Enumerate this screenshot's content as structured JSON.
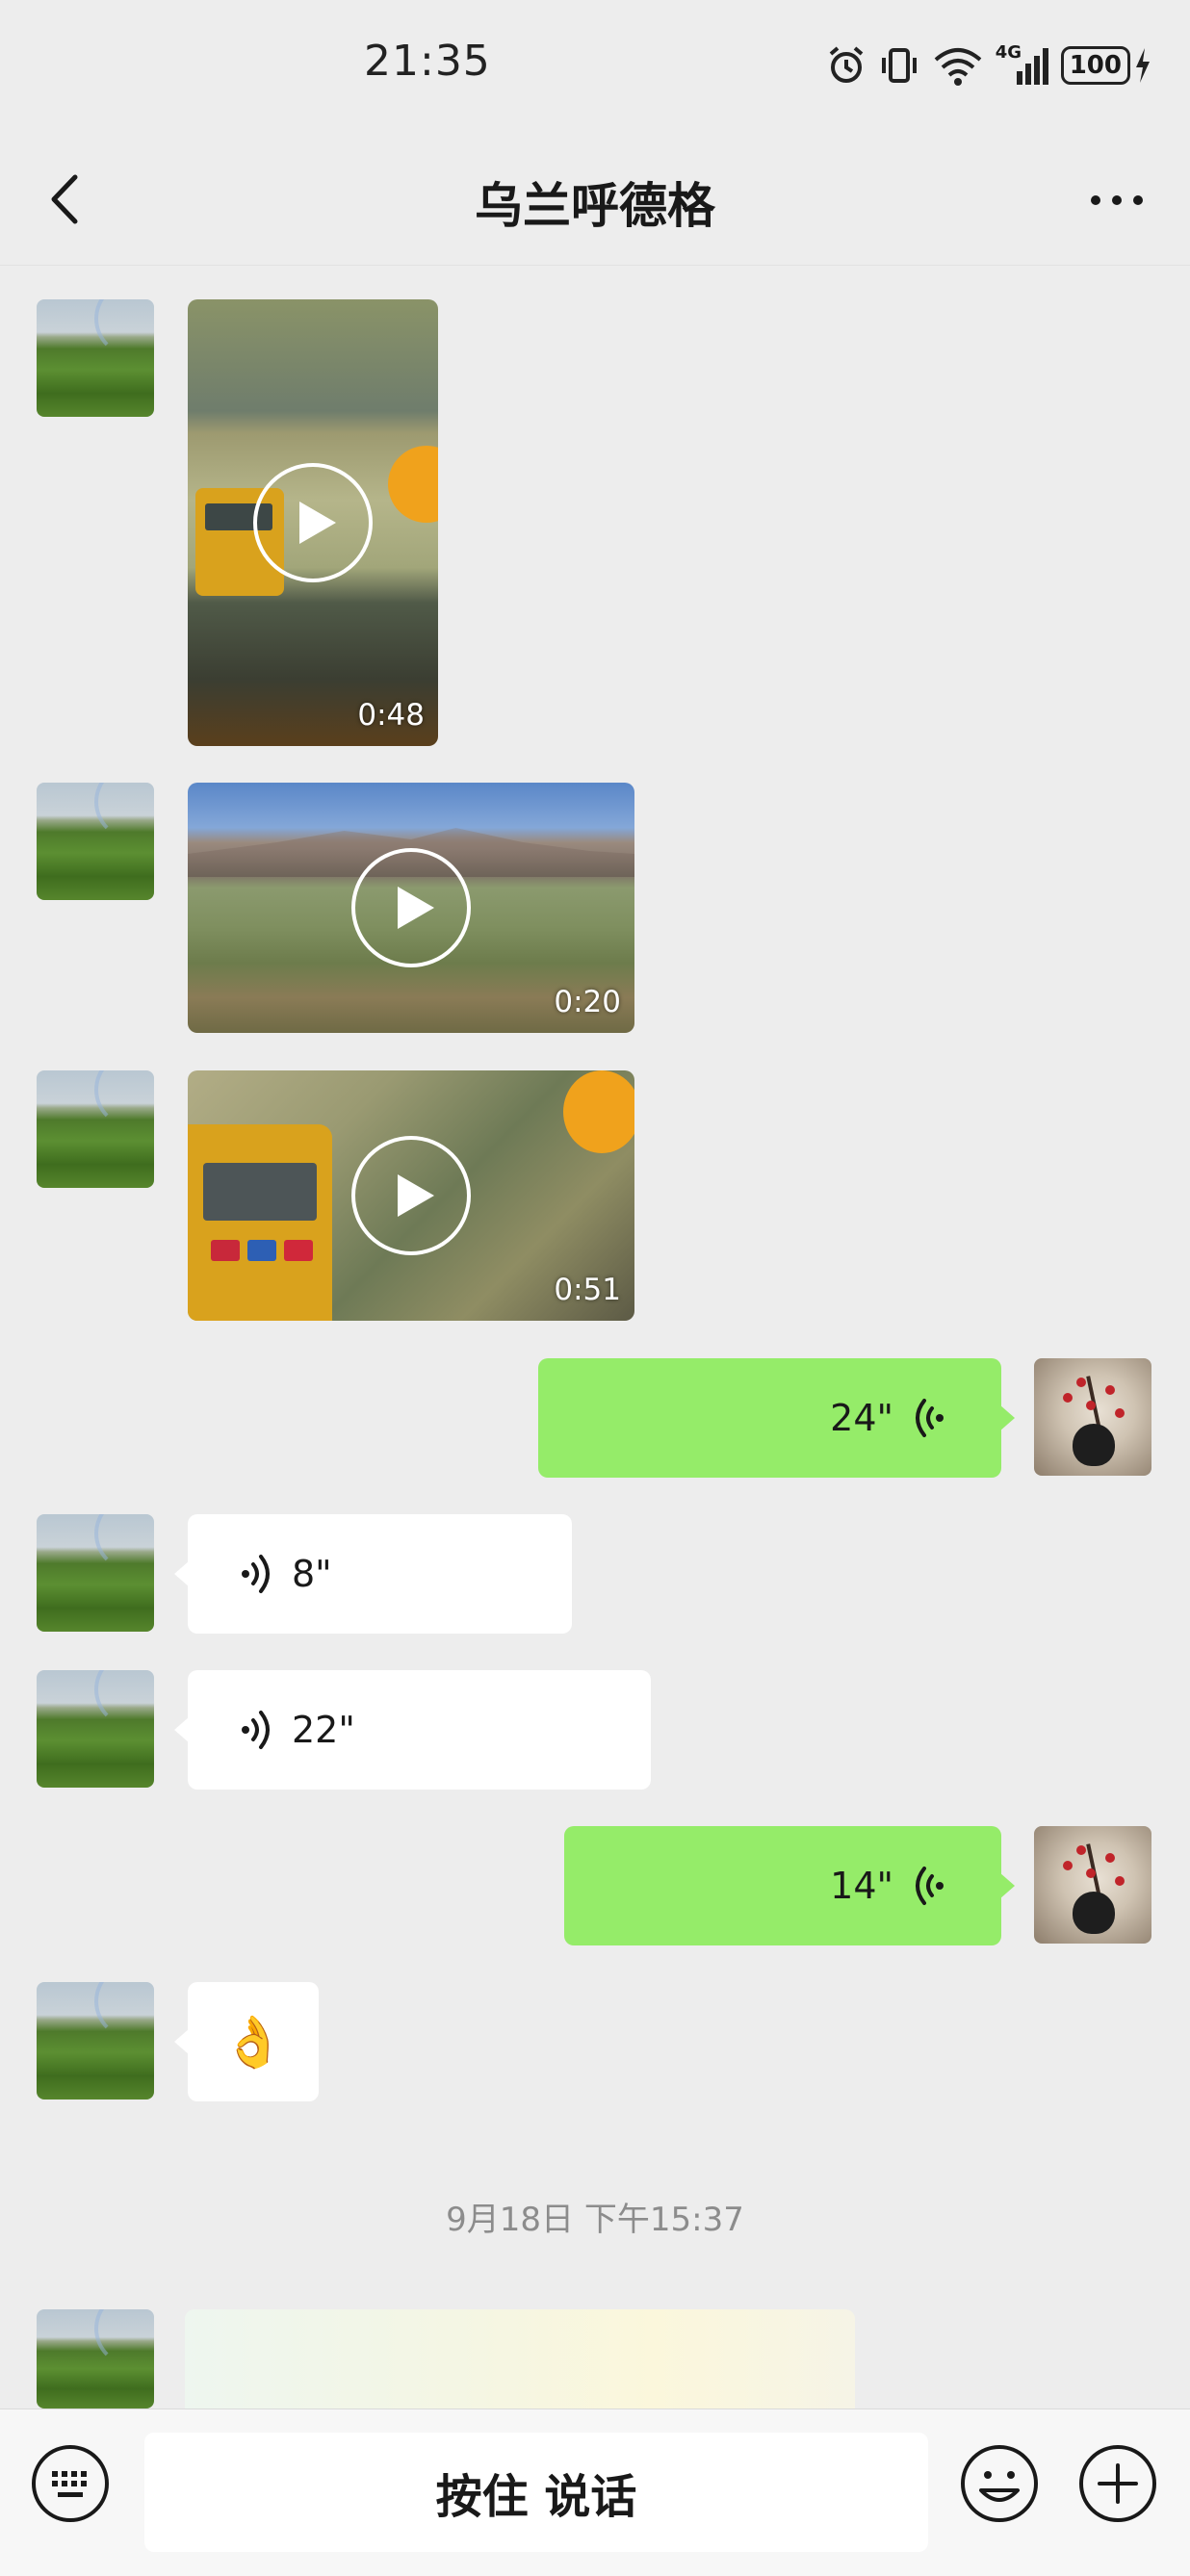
{
  "status_bar": {
    "time": "21:35",
    "network": "4G",
    "battery": "100",
    "icons": [
      "alarm-icon",
      "vibrate-icon",
      "wifi-icon",
      "signal-icon",
      "battery-icon",
      "charging-icon"
    ]
  },
  "nav": {
    "title": "乌兰呼德格",
    "back_icon": "chevron-left-icon",
    "more_icon": "more-dots-icon"
  },
  "messages": [
    {
      "type": "video",
      "side": "left",
      "duration": "0:48"
    },
    {
      "type": "video",
      "side": "left",
      "duration": "0:20"
    },
    {
      "type": "video",
      "side": "left",
      "duration": "0:51"
    },
    {
      "type": "voice",
      "side": "right",
      "duration": "24\""
    },
    {
      "type": "voice",
      "side": "left",
      "duration": "8\""
    },
    {
      "type": "voice",
      "side": "left",
      "duration": "22\""
    },
    {
      "type": "voice",
      "side": "right",
      "duration": "14\""
    },
    {
      "type": "emoji",
      "side": "left",
      "emoji": "👌"
    },
    {
      "type": "timestamp",
      "text": "9月18日 下午15:37"
    },
    {
      "type": "image",
      "side": "left"
    }
  ],
  "input_bar": {
    "hold_to_talk_label": "按住 说话",
    "keyboard_icon": "keyboard-icon",
    "emoji_icon": "smiley-icon",
    "plus_icon": "plus-circle-icon"
  },
  "colors": {
    "background": "#ededed",
    "bubble_self": "#95ec69",
    "bubble_other": "#ffffff",
    "timestamp": "#8c8c8c"
  }
}
